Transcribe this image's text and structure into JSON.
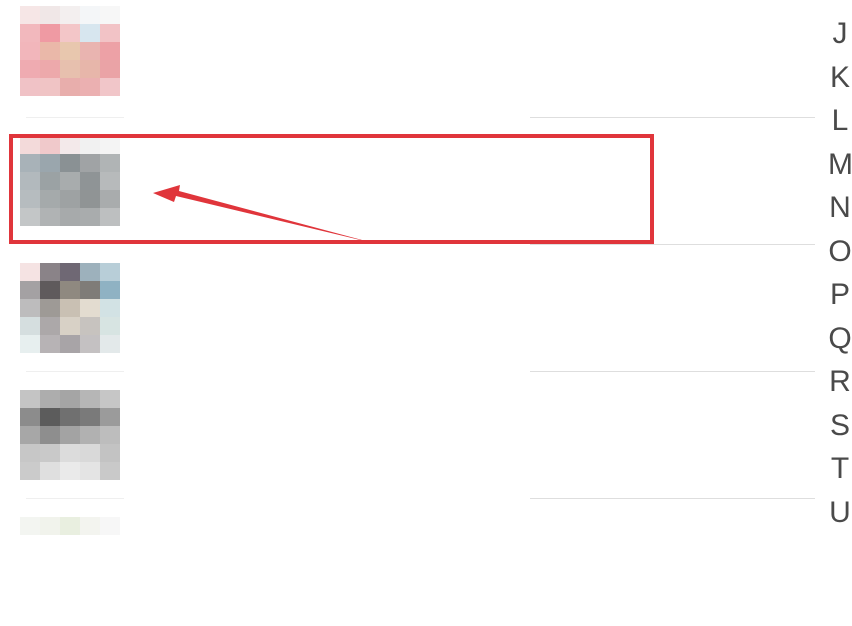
{
  "contact_list": {
    "rows": [
      {
        "avatar": "pixelated-avatar"
      },
      {
        "avatar": "pixelated-avatar"
      },
      {
        "avatar": "pixelated-avatar"
      },
      {
        "avatar": "pixelated-avatar"
      },
      {
        "avatar": "pixelated-avatar"
      }
    ]
  },
  "alpha_index": {
    "letters": [
      "J",
      "K",
      "L",
      "M",
      "N",
      "O",
      "P",
      "Q",
      "R",
      "S",
      "T",
      "U"
    ]
  },
  "annotation": {
    "highlight_color": "#e0353b",
    "arrow_color": "#e0353b",
    "icon": "arrow-pointer"
  }
}
